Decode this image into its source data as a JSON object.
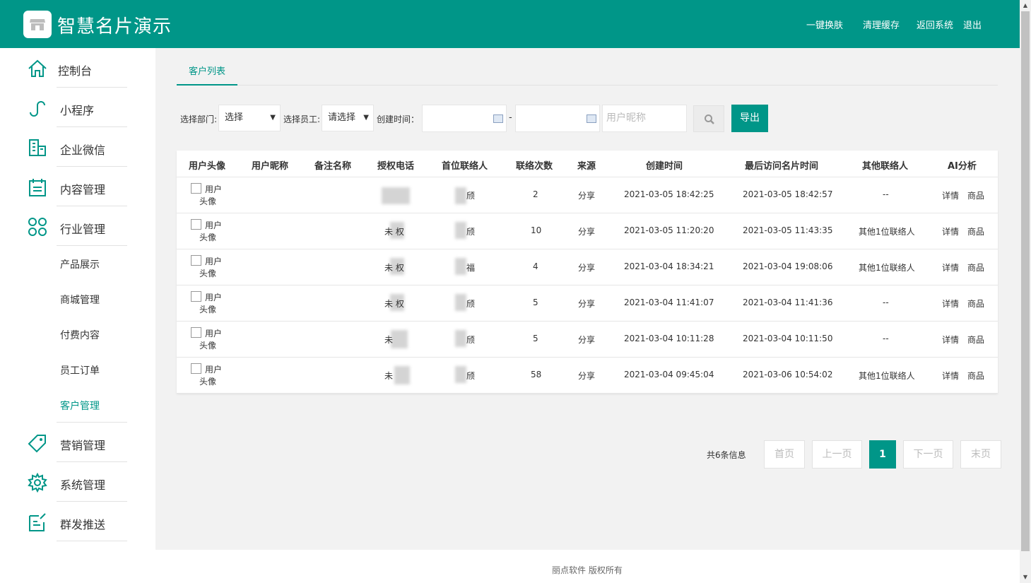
{
  "app": {
    "title": "智慧名片演示"
  },
  "header_links": {
    "skin": "一键换肤",
    "cache": "清理缓存",
    "back": "返回系统",
    "logout": "退出"
  },
  "sidebar": {
    "items": [
      {
        "label": "控制台",
        "icon": "home-icon"
      },
      {
        "label": "小程序",
        "icon": "link-icon"
      },
      {
        "label": "企业微信",
        "icon": "building-icon"
      },
      {
        "label": "内容管理",
        "icon": "calendar-icon"
      },
      {
        "label": "行业管理",
        "icon": "clover-icon"
      },
      {
        "label": "营销管理",
        "icon": "tag-icon"
      },
      {
        "label": "系统管理",
        "icon": "gear-icon"
      },
      {
        "label": "群发推送",
        "icon": "edit-icon"
      }
    ],
    "sub_items": [
      "产品展示",
      "商城管理",
      "付费内容",
      "员工订单",
      "客户管理"
    ],
    "active_sub": "客户管理"
  },
  "tabs": [
    {
      "label": "客户列表"
    }
  ],
  "filters": {
    "dept_label": "选择部门:",
    "dept_value": "选择",
    "staff_label": "选择员工:",
    "staff_value": "请选择",
    "time_label": "创建时间：",
    "range_sep": "-",
    "nickname_placeholder": "用户昵称",
    "export_label": "导出"
  },
  "table": {
    "headers": [
      "用户头像",
      "用户昵称",
      "备注名称",
      "授权电话",
      "首位联络人",
      "联络次数",
      "来源",
      "创建时间",
      "最后访问名片时间",
      "其他联络人",
      "AI分析"
    ],
    "avatar_text_1": "用户",
    "avatar_text_2": "头像",
    "action_detail": "详情",
    "action_goods": "商品",
    "rows": [
      {
        "phone": "",
        "contact": "颀",
        "count": "2",
        "source": "分享",
        "created": "2021-03-05 18:42:25",
        "last_visit": "2021-03-05 18:42:57",
        "others": "--"
      },
      {
        "phone": "未 权",
        "contact": "颀",
        "count": "10",
        "source": "分享",
        "created": "2021-03-05 11:20:20",
        "last_visit": "2021-03-05 11:43:35",
        "others": "其他1位联络人"
      },
      {
        "phone": "未 权",
        "contact": "福",
        "count": "4",
        "source": "分享",
        "created": "2021-03-04 18:34:21",
        "last_visit": "2021-03-04 19:08:06",
        "others": "其他1位联络人"
      },
      {
        "phone": "未 权",
        "contact": "颀",
        "count": "5",
        "source": "分享",
        "created": "2021-03-04 11:41:07",
        "last_visit": "2021-03-04 11:41:36",
        "others": "--"
      },
      {
        "phone": "未",
        "contact": "颀",
        "count": "5",
        "source": "分享",
        "created": "2021-03-04 10:11:28",
        "last_visit": "2021-03-04 10:11:50",
        "others": "--"
      },
      {
        "phone": "未",
        "contact": "颀",
        "count": "58",
        "source": "分享",
        "created": "2021-03-04 09:45:04",
        "last_visit": "2021-03-06 10:54:02",
        "others": "其他1位联络人"
      }
    ]
  },
  "pagination": {
    "info": "共6条信息",
    "first": "首页",
    "prev": "上一页",
    "current": "1",
    "next": "下一页",
    "last": "末页"
  },
  "footer": {
    "text": "丽点软件 版权所有"
  },
  "colors": {
    "primary": "#009688",
    "content_bg": "#f2f2f2"
  }
}
